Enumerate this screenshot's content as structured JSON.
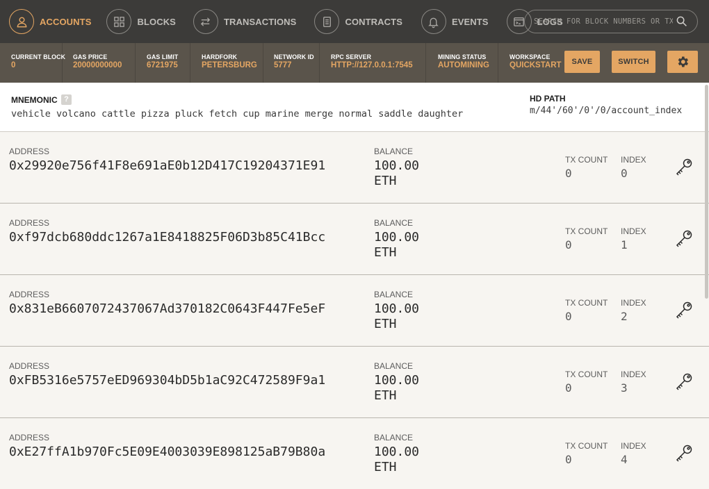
{
  "nav": {
    "items": [
      {
        "label": "Accounts",
        "icon": "user-icon",
        "active": true
      },
      {
        "label": "Blocks",
        "icon": "grid-icon"
      },
      {
        "label": "Transactions",
        "icon": "swap-icon"
      },
      {
        "label": "Contracts",
        "icon": "document-icon"
      },
      {
        "label": "Events",
        "icon": "bell-icon"
      },
      {
        "label": "Logs",
        "icon": "terminal-icon"
      }
    ],
    "search_placeholder": "SEARCH FOR BLOCK NUMBERS OR TX HASHES"
  },
  "status": {
    "current_block": {
      "label": "Current Block",
      "value": "0"
    },
    "gas_price": {
      "label": "Gas Price",
      "value": "20000000000"
    },
    "gas_limit": {
      "label": "Gas Limit",
      "value": "6721975"
    },
    "hardfork": {
      "label": "Hardfork",
      "value": "Petersburg"
    },
    "network_id": {
      "label": "Network ID",
      "value": "5777"
    },
    "rpc_server": {
      "label": "RPC Server",
      "value": "HTTP://127.0.0.1:7545"
    },
    "mining_status": {
      "label": "Mining Status",
      "value": "Automining"
    },
    "workspace": {
      "label": "Workspace",
      "value": "Quickstart"
    },
    "save_label": "Save",
    "switch_label": "Switch"
  },
  "mnemonic": {
    "label": "Mnemonic",
    "help": "?",
    "words": "vehicle volcano cattle pizza pluck fetch cup marine merge normal saddle daughter",
    "hd_path_label": "HD Path",
    "hd_path": "m/44'/60'/0'/0/account_index"
  },
  "labels": {
    "address": "Address",
    "balance": "Balance",
    "tx_count": "TX Count",
    "index": "Index"
  },
  "accounts": [
    {
      "address": "0x29920e756f41F8e691aE0b12D417C19204371E91",
      "balance": "100.00 ETH",
      "tx_count": "0",
      "index": "0"
    },
    {
      "address": "0xf97dcb680ddc1267a1E8418825F06D3b85C41Bcc",
      "balance": "100.00 ETH",
      "tx_count": "0",
      "index": "1"
    },
    {
      "address": "0x831eB6607072437067Ad370182C0643F447Fe5eF",
      "balance": "100.00 ETH",
      "tx_count": "0",
      "index": "2"
    },
    {
      "address": "0xFB5316e5757eED969304bD5b1aC92C472589F9a1",
      "balance": "100.00 ETH",
      "tx_count": "0",
      "index": "3"
    },
    {
      "address": "0xE27ffA1b970Fc5E09E4003039E898125aB79B80a",
      "balance": "100.00 ETH",
      "tx_count": "0",
      "index": "4"
    }
  ],
  "colors": {
    "accent": "#e4a663",
    "nav_bg": "#3c3b39",
    "status_bg": "#5a544b"
  }
}
